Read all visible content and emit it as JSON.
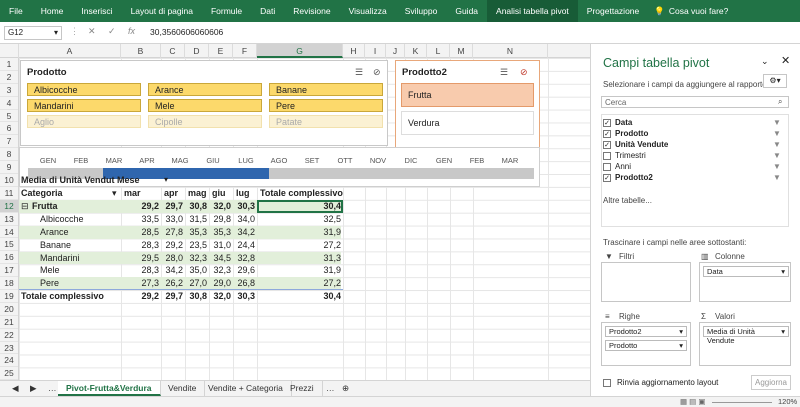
{
  "ribbon": {
    "tabs": [
      "File",
      "Home",
      "Inserisci",
      "Layout di pagina",
      "Formule",
      "Dati",
      "Revisione",
      "Visualizza",
      "Sviluppo",
      "Guida",
      "Analisi tabella pivot",
      "Progettazione"
    ],
    "tell_me": "Cosa vuoi fare?"
  },
  "formula_bar": {
    "name_box": "G12",
    "cancel": "✕",
    "enter": "✓",
    "fx": "fx",
    "value": "30,3560606060606"
  },
  "columns": [
    "A",
    "B",
    "C",
    "D",
    "E",
    "F",
    "G",
    "H",
    "I",
    "J",
    "K",
    "L",
    "M",
    "N"
  ],
  "rows": [
    "1",
    "2",
    "3",
    "4",
    "5",
    "6",
    "7",
    "8",
    "9",
    "10",
    "11",
    "12",
    "13",
    "14",
    "15",
    "16",
    "17",
    "18",
    "19",
    "20",
    "21",
    "22",
    "23",
    "24",
    "25"
  ],
  "slicer_prodotto": {
    "title": "Prodotto",
    "items": [
      "Albicocche",
      "Arance",
      "Banane",
      "Mandarini",
      "Mele",
      "Pere",
      "Aglio",
      "Cipolle",
      "Patate"
    ]
  },
  "slicer_prodotto2": {
    "title": "Prodotto2",
    "items": [
      "Frutta",
      "Verdura"
    ]
  },
  "timeline": {
    "months": [
      "GEN",
      "FEB",
      "MAR",
      "APR",
      "MAG",
      "GIU",
      "LUG",
      "AGO",
      "SET",
      "OTT",
      "NOV",
      "DIC",
      "GEN",
      "FEB",
      "MAR"
    ]
  },
  "pivot": {
    "title": "Media di Unità Vendut Mese",
    "headers": [
      "Categoria",
      "mar",
      "apr",
      "mag",
      "giu",
      "lug",
      "Totale complessivo"
    ],
    "group": {
      "label": "Frutta",
      "values": [
        "29,2",
        "29,7",
        "30,8",
        "32,0",
        "30,3",
        "30,4"
      ]
    },
    "rows": [
      {
        "label": "Albicocche",
        "values": [
          "33,5",
          "33,0",
          "31,5",
          "29,8",
          "34,0",
          "32,5"
        ]
      },
      {
        "label": "Arance",
        "values": [
          "28,5",
          "27,8",
          "35,3",
          "35,3",
          "34,2",
          "31,9"
        ]
      },
      {
        "label": "Banane",
        "values": [
          "28,3",
          "29,2",
          "23,5",
          "31,0",
          "24,4",
          "27,2"
        ]
      },
      {
        "label": "Mandarini",
        "values": [
          "29,5",
          "28,0",
          "32,3",
          "34,5",
          "32,8",
          "31,3"
        ]
      },
      {
        "label": "Mele",
        "values": [
          "28,3",
          "34,2",
          "35,0",
          "32,3",
          "29,6",
          "31,9"
        ]
      },
      {
        "label": "Pere",
        "values": [
          "27,3",
          "26,2",
          "27,0",
          "29,0",
          "26,8",
          "27,2"
        ]
      }
    ],
    "total": {
      "label": "Totale complessivo",
      "values": [
        "29,2",
        "29,7",
        "30,8",
        "32,0",
        "30,3",
        "30,4"
      ]
    }
  },
  "pane": {
    "title": "Campi tabella pivot",
    "subtitle": "Selezionare i campi da aggiungere al rapporto:",
    "search_placeholder": "Cerca",
    "fields": [
      {
        "label": "Data",
        "checked": true
      },
      {
        "label": "Prodotto",
        "checked": true
      },
      {
        "label": "Unità Vendute",
        "checked": true
      },
      {
        "label": "Trimestri",
        "checked": false
      },
      {
        "label": "Anni",
        "checked": false
      },
      {
        "label": "Prodotto2",
        "checked": true
      }
    ],
    "more_tables": "Altre tabelle...",
    "drag_hint": "Trascinare i campi nelle aree sottostanti:",
    "filters_label": "Filtri",
    "columns_label": "Colonne",
    "columns_value": "Data",
    "rows_label": "Righe",
    "rows_values": [
      "Prodotto2",
      "Prodotto"
    ],
    "values_label": "Valori",
    "values_value": "Media di Unità Vendute",
    "defer_label": "Rinvia aggiornamento layout",
    "update_button": "Aggiorna"
  },
  "sheet_tabs": [
    "Pivot-Frutta&Verdura",
    "Vendite",
    "Vendite + Categoria",
    "Prezzi"
  ],
  "status": {
    "zoom": "120%"
  },
  "colors": {
    "excel_green": "#217346",
    "slicer_selected": "#fcd96b",
    "slicer2_selected": "#f8cbad",
    "timeline_selected": "#2f66ae",
    "band": "#e2efda"
  }
}
